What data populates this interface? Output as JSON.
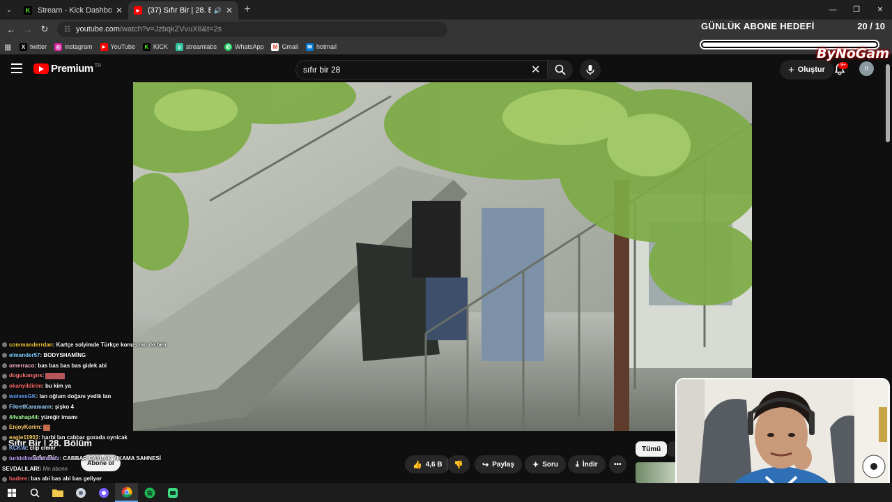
{
  "browser": {
    "tabs": [
      {
        "title": "Stream - Kick Dashboard",
        "favicon": "K",
        "favicon_color": "#53fc18"
      },
      {
        "title": "(37) Sıfır Bir | 28. Bölüm - Yo",
        "favicon": "▶",
        "favicon_color": "#ff0000"
      }
    ],
    "url_host": "youtube.com",
    "url_path": "/watch?v=JzbqkZVvuX8&t=2s",
    "bookmarks": [
      {
        "label": "twitter",
        "icon": "X",
        "color": "#000000"
      },
      {
        "label": "instagram",
        "icon": "◎",
        "color": "#d6249f"
      },
      {
        "label": "YouTube",
        "icon": "▶",
        "color": "#ff0000"
      },
      {
        "label": "KICK",
        "icon": "K",
        "color": "#53fc18"
      },
      {
        "label": "streamlabs",
        "icon": "s",
        "color": "#31c3a2"
      },
      {
        "label": "WhatsApp",
        "icon": "✆",
        "color": "#25d366"
      },
      {
        "label": "Gmail",
        "icon": "M",
        "color": "#ea4335"
      },
      {
        "label": "hotmail",
        "icon": "✉",
        "color": "#0078d4"
      }
    ]
  },
  "overlay": {
    "goal_label": "GÜNLÜK ABONE HEDEFİ",
    "goal_count": "20 / 10",
    "goal_progress": 1.0,
    "brand": "ByNoGam"
  },
  "youtube": {
    "logo_word": "Premium",
    "logo_region": "TR",
    "search_query": "sıfır bir 28",
    "create_label": "Oluştur",
    "notifications_badge": "9+",
    "avatar_letter": "n",
    "video_title": "Sıfır Bir | 28. Bölüm",
    "channel_name": "Sıfır Bir",
    "subscribers": "186 Mn abone",
    "subscribe_label": "Abone ol",
    "like_count": "4,6 B",
    "share_label": "Paylaş",
    "ask_label": "Soru",
    "download_label": "İndir",
    "chip_all": "Tümü"
  },
  "chat": [
    {
      "user": "commanderrdan",
      "color": "#f0c43c",
      "msg": ": Kartçe solyimde Türkçe konuş mo de ben"
    },
    {
      "user": "elmander57",
      "color": "#7fd0ff",
      "msg": ": BODYSHAMİNG"
    },
    {
      "user": "omerraco",
      "color": "#ffb8d8",
      "msg": ": bas bas bas bas gidek abi"
    },
    {
      "user": "dogukangns",
      "color": "#ff7a7a",
      "msg": ": ",
      "emote": "wide"
    },
    {
      "user": "okanyildirim",
      "color": "#ff6a6a",
      "msg": ": bu kim ya"
    },
    {
      "user": "wolvesGK",
      "color": "#6aa8ff",
      "msg": ": lan oğlum doğanı yedik lan"
    },
    {
      "user": "FikretKaramann",
      "color": "#9bd7ff",
      "msg": ": şişko 4"
    },
    {
      "user": "44vahap44",
      "color": "#a8ff9b",
      "msg": ": yüreğir imamı"
    },
    {
      "user": "EnjoyKerim",
      "color": "#ffd36a",
      "msg": ": ",
      "emote": "small"
    },
    {
      "user": "eagle11903",
      "color": "#ffd36a",
      "msg": ": harbi lan cabbar gorada oynicak"
    },
    {
      "user": "KCKW",
      "color": "#8fb5ff",
      "msg": ": clip cimer"
    },
    {
      "user": "turkbilimadamiimiz",
      "color": "#c9a8ff",
      "msg": ": CABBAR ÇAYLAK YIKAMA SAHNESİ"
    },
    {
      "user": "",
      "color": "#ffffff",
      "msg": "SEVDALILAR!"
    },
    {
      "user": "hadere",
      "color": "#ff6a6a",
      "msg": ": bas abi bas abi bas geliyor"
    }
  ],
  "taskbar": [
    "windows-start",
    "search",
    "file-explorer",
    "app",
    "app2",
    "chrome",
    "spotify",
    "app3"
  ]
}
